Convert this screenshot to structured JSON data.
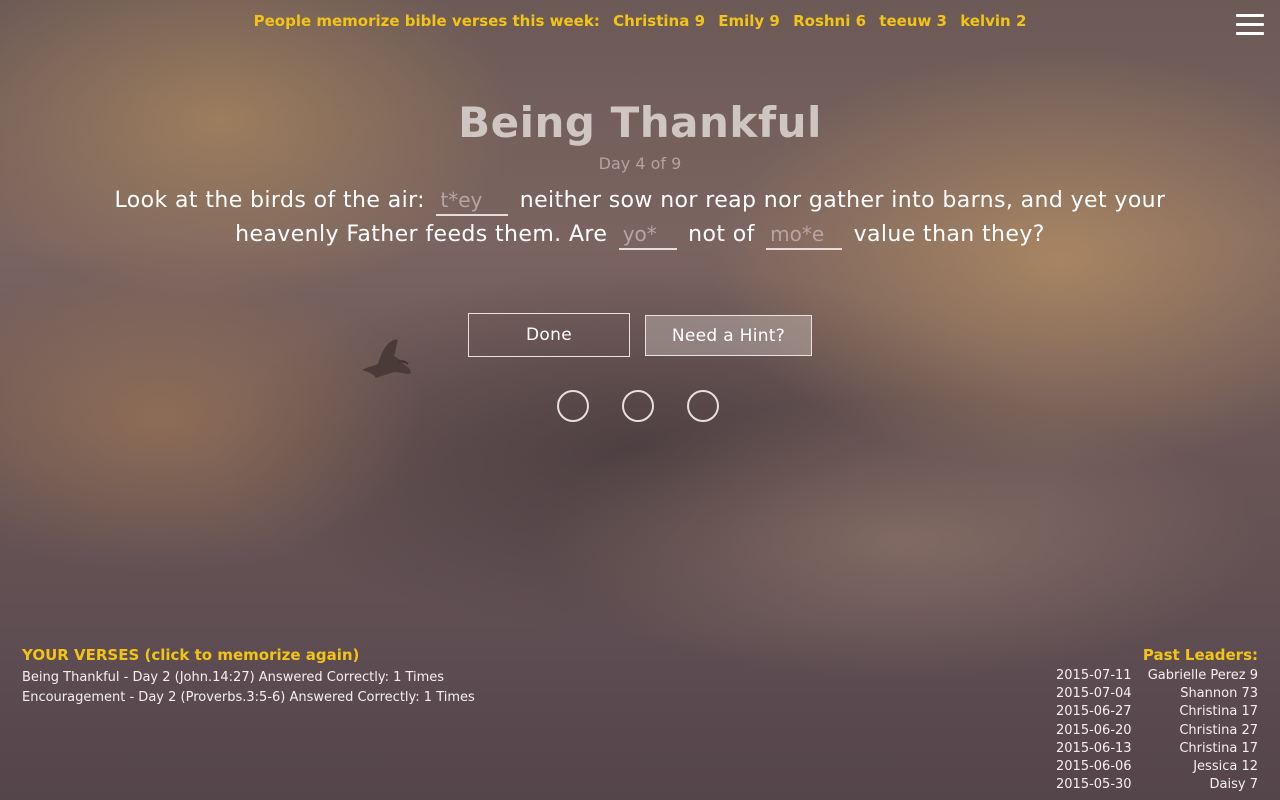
{
  "ticker": {
    "label": "People memorize bible verses this week:",
    "entries": [
      "Christina 9",
      "Emily 9",
      "Roshni 6",
      "teeuw 3",
      "kelvin 2"
    ]
  },
  "menu_icon": "hamburger-menu-icon",
  "title": "Being Thankful",
  "progress": "Day 4 of 9",
  "verse": {
    "part1": "Look at the birds of the air:",
    "blank1_placeholder": "t*ey",
    "part2": "neither sow nor reap nor gather into barns, and yet your heavenly Father feeds them. Are",
    "blank2_placeholder": "yo*",
    "part3": "not of",
    "blank3_placeholder": "mo*e",
    "part4": "value than they?"
  },
  "buttons": {
    "done": "Done",
    "hint": "Need a Hint?"
  },
  "your_verses": {
    "heading": "YOUR VERSES (click to memorize again)",
    "items": [
      "Being Thankful - Day 2 (John.14:27) Answered Correctly: 1 Times",
      "Encouragement - Day 2 (Proverbs.3:5-6) Answered Correctly: 1 Times"
    ]
  },
  "past_leaders": {
    "heading": "Past Leaders:",
    "rows": [
      {
        "date": "2015-07-11",
        "name": "Gabrielle Perez 9"
      },
      {
        "date": "2015-07-04",
        "name": "Shannon 73"
      },
      {
        "date": "2015-06-27",
        "name": "Christina 17"
      },
      {
        "date": "2015-06-20",
        "name": "Christina 27"
      },
      {
        "date": "2015-06-13",
        "name": "Christina 17"
      },
      {
        "date": "2015-06-06",
        "name": "Jessica 12"
      },
      {
        "date": "2015-05-30",
        "name": "Daisy 7"
      }
    ]
  },
  "colors": {
    "accent": "#f2c418",
    "text": "#ffffff"
  }
}
